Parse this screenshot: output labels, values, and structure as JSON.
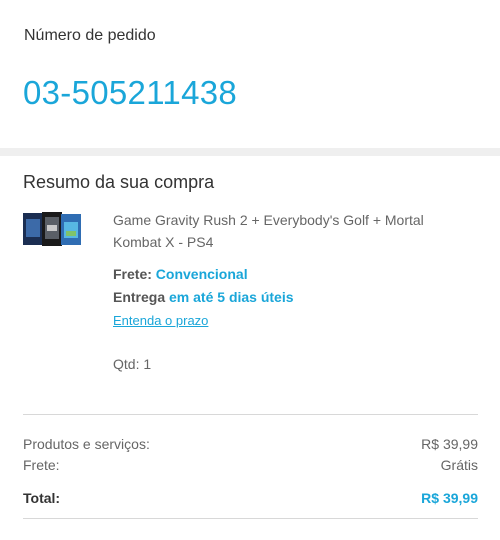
{
  "order": {
    "label": "Número de pedido",
    "number": "03-505211438"
  },
  "summary": {
    "title": "Resumo da sua compra",
    "product": {
      "name": "Game Gravity Rush 2 + Everybody's Golf + Mortal Kombat X  - PS4",
      "freight_label": "Frete:",
      "freight_value": "Convencional",
      "delivery_label": "Entrega",
      "delivery_value": "em até 5 dias úteis",
      "deadline_link": "Entenda o prazo",
      "quantity": "Qtd: 1"
    },
    "totals": {
      "products_label": "Produtos e serviços:",
      "products_value": "R$ 39,99",
      "freight_label": "Frete:",
      "freight_value": "Grátis",
      "total_label": "Total:",
      "total_value": "R$ 39,99"
    }
  },
  "colors": {
    "accent": "#1aa6d9",
    "text": "#333333",
    "muted": "#666666",
    "band": "#efefef"
  }
}
